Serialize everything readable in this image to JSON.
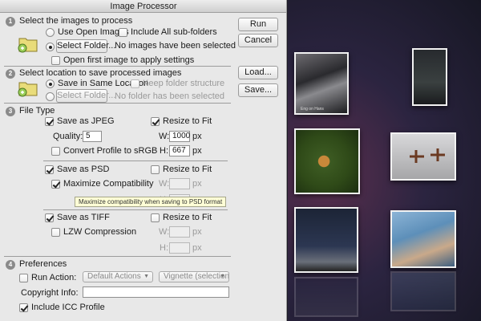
{
  "window": {
    "title": "Image Processor"
  },
  "buttons": {
    "run": "Run",
    "cancel": "Cancel",
    "load": "Load...",
    "save": "Save..."
  },
  "section1": {
    "number": "1",
    "title": "Select the images to process",
    "use_open_images": "Use Open Images",
    "include_subfolders": "Include All sub-folders",
    "select_folder": "Select Folder...",
    "no_images": "No images have been selected",
    "open_first": "Open first image to apply settings"
  },
  "section2": {
    "number": "2",
    "title": "Select location to save processed images",
    "save_same": "Save in Same Location",
    "keep_structure": "Keep folder structure",
    "select_folder": "Select Folder...",
    "no_folder": "No folder has been selected"
  },
  "section3": {
    "number": "3",
    "title": "File Type",
    "jpeg": {
      "save_as": "Save as JPEG",
      "resize": "Resize to Fit",
      "quality_label": "Quality:",
      "quality": "5",
      "w_label": "W:",
      "w_value": "1000",
      "w_unit": "px",
      "h_label": "H:",
      "h_value": "667",
      "h_unit": "px",
      "convert": "Convert Profile to sRGB"
    },
    "psd": {
      "save_as": "Save as PSD",
      "resize": "Resize to Fit",
      "maximize": "Maximize Compatibility",
      "w_label": "W:",
      "w_unit": "px",
      "h_label": "H:",
      "h_unit": "px",
      "tooltip": "Maximize compatibility when saving to PSD format"
    },
    "tiff": {
      "save_as": "Save as TIFF",
      "resize": "Resize to Fit",
      "lzw": "LZW Compression",
      "w_label": "W:",
      "w_unit": "px",
      "h_label": "H:",
      "h_unit": "px"
    }
  },
  "section4": {
    "number": "4",
    "title": "Preferences",
    "run_action": "Run Action:",
    "action_set": "Default Actions",
    "action": "Vignette (selection",
    "copyright": "Copyright Info:",
    "icc": "Include ICC Profile"
  },
  "photos": {
    "caption": "Eng on Hans"
  },
  "colors": {
    "dialog_bg": "#e8e8e8",
    "backdrop": "#2b2440",
    "tooltip_bg": "#ffffd6"
  }
}
